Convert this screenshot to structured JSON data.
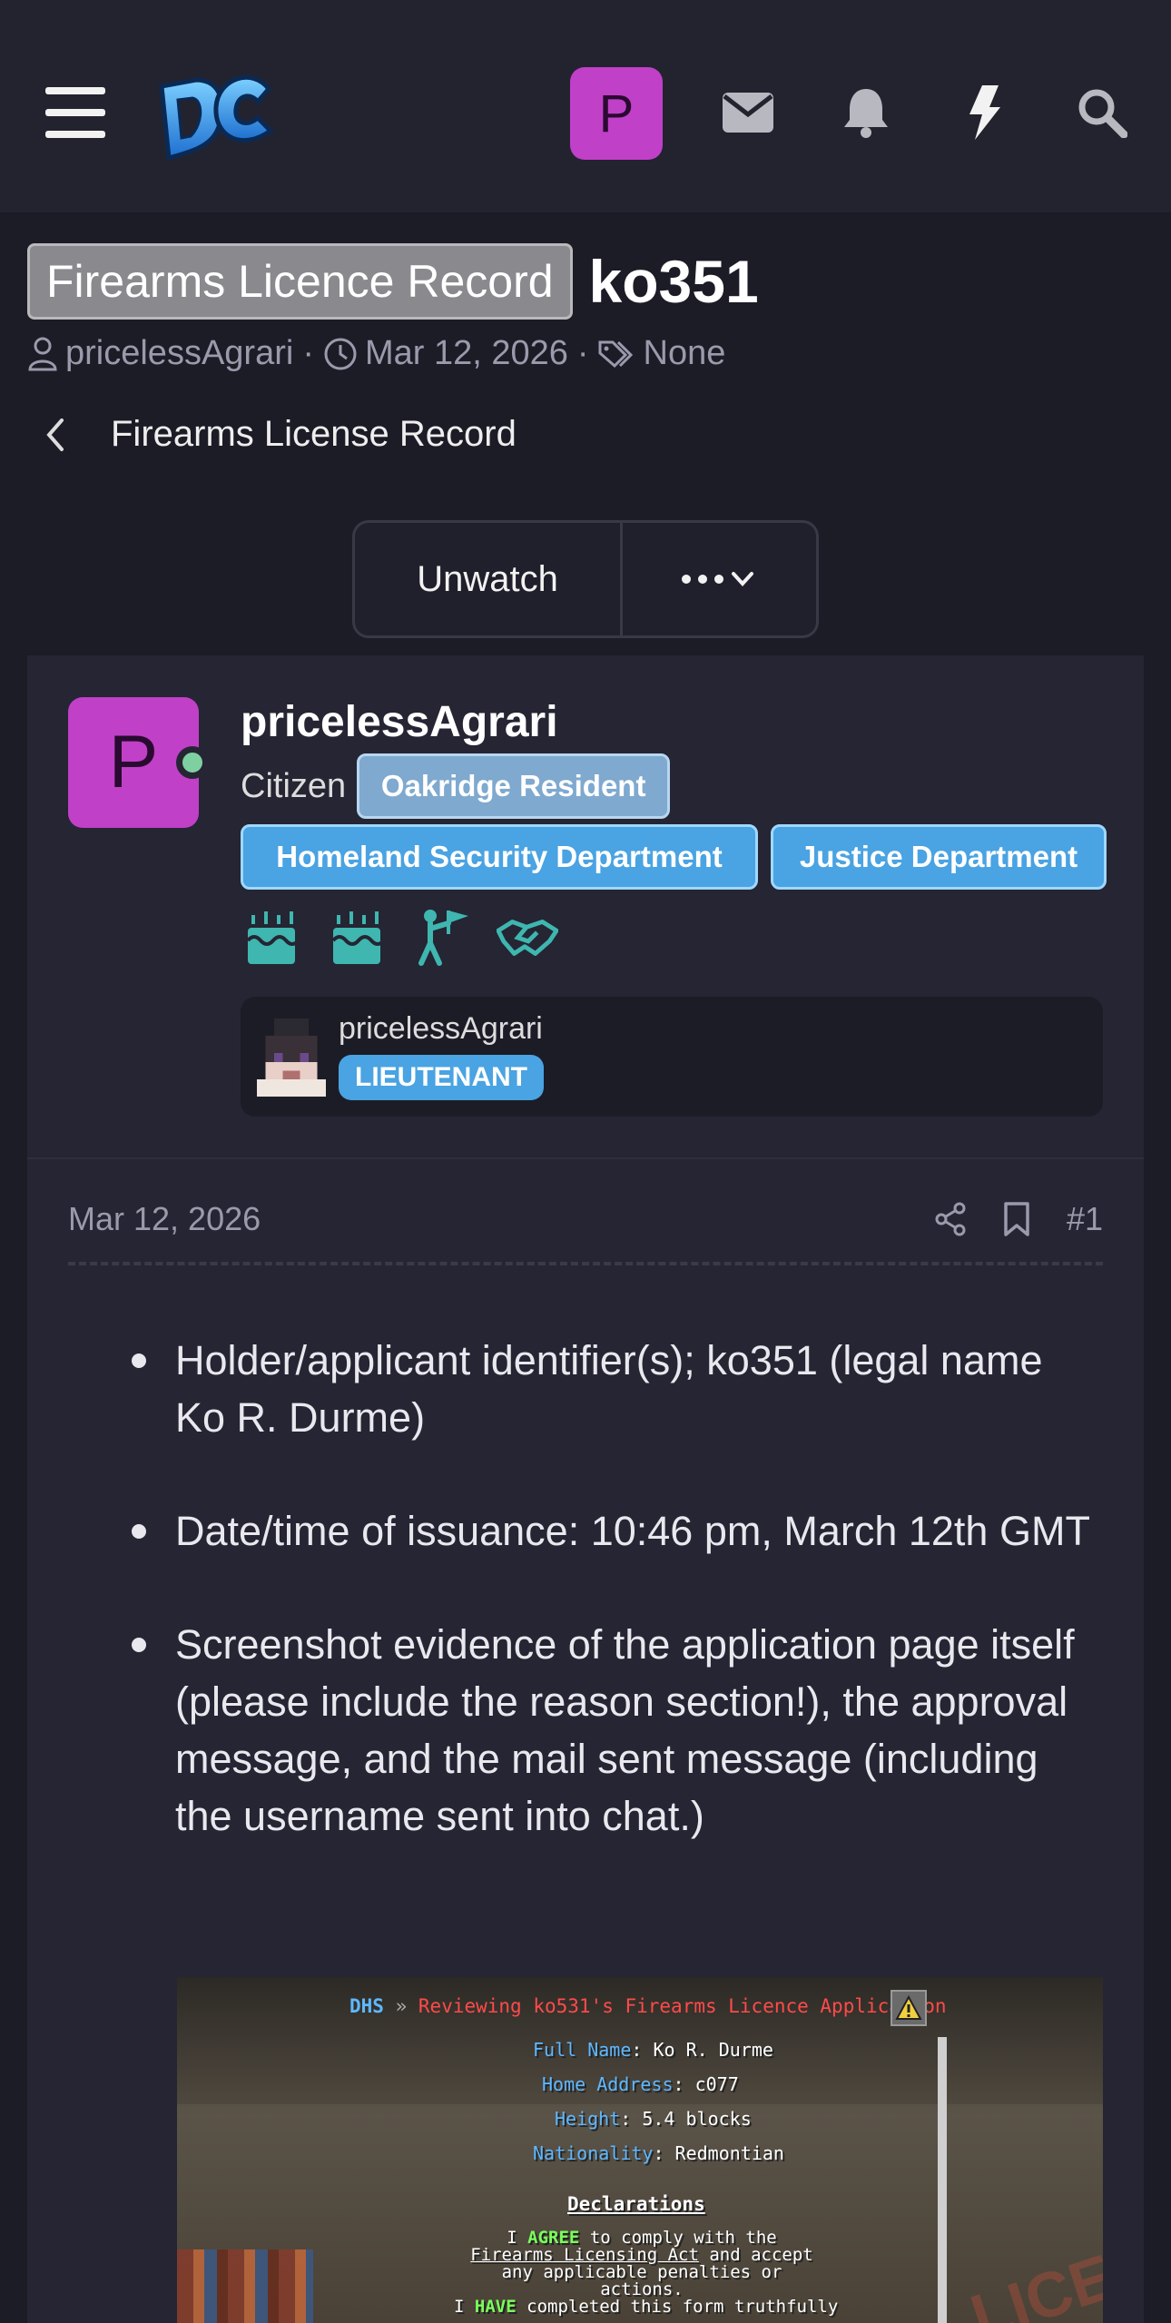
{
  "header": {
    "logo_text": "DC",
    "user_initial": "P",
    "icons": [
      "menu-icon",
      "mail-icon",
      "bell-icon",
      "lightning-icon",
      "search-icon"
    ]
  },
  "thread": {
    "prefix": "Firearms Licence Record",
    "title": "ko351",
    "author": "pricelessAgrari",
    "date": "Mar 12, 2026",
    "tags": "None",
    "meta_sep": "·",
    "breadcrumb": "Firearms License Record",
    "unwatch_label": "Unwatch"
  },
  "post": {
    "avatar_initial": "P",
    "username": "pricelessAgrari",
    "user_title": "Citizen",
    "badges_row1": [
      "Oakridge Resident"
    ],
    "badges_row2": [
      "Homeland Security Department",
      "Justice Department"
    ],
    "trophy_icons": [
      "cake-icon",
      "cake-icon",
      "flag-person-icon",
      "handshake-icon"
    ],
    "mc_name": "pricelessAgrari",
    "mc_rank": "LIEUTENANT",
    "date": "Mar 12, 2026",
    "number": "#1",
    "bullets": [
      "Holder/applicant identifier(s); ko351 (legal name Ko R. Durme)",
      "Date/time of issuance: 10:46 pm, March 12th GMT",
      "Screenshot evidence of the application page itself (please include the reason section!), the approval message, and the mail sent message (including the username sent into chat.)"
    ]
  },
  "screenshot": {
    "hdr_dhs": "DHS",
    "hdr_sep": "»",
    "hdr_title": "Reviewing ko531's Firearms Licence Application",
    "fields": [
      {
        "label": "Full Name",
        "value": "Ko R. Durme"
      },
      {
        "label": "Home Address",
        "value": "c077"
      },
      {
        "label": "Height",
        "value": "5.4 blocks"
      },
      {
        "label": "Nationality",
        "value": "Redmontian"
      }
    ],
    "declarations": "Declarations",
    "decl1_pre": "I",
    "decl1_kw": "AGREE",
    "decl1_mid": "to comply with the",
    "decl1_link": "Firearms Licensing Act",
    "decl1_post": "and accept any applicable penalties or actions.",
    "decl2_pre": "I",
    "decl2_kw": "HAVE",
    "decl2_post": "completed this form truthfully",
    "bg_text": "LICENSE"
  },
  "colors": {
    "bg": "#1c1c27",
    "topbar": "#23232f",
    "accent_purple": "#c040c8",
    "badge_blue": "#4aa3e2",
    "trophy_teal": "#3fb6b0"
  }
}
